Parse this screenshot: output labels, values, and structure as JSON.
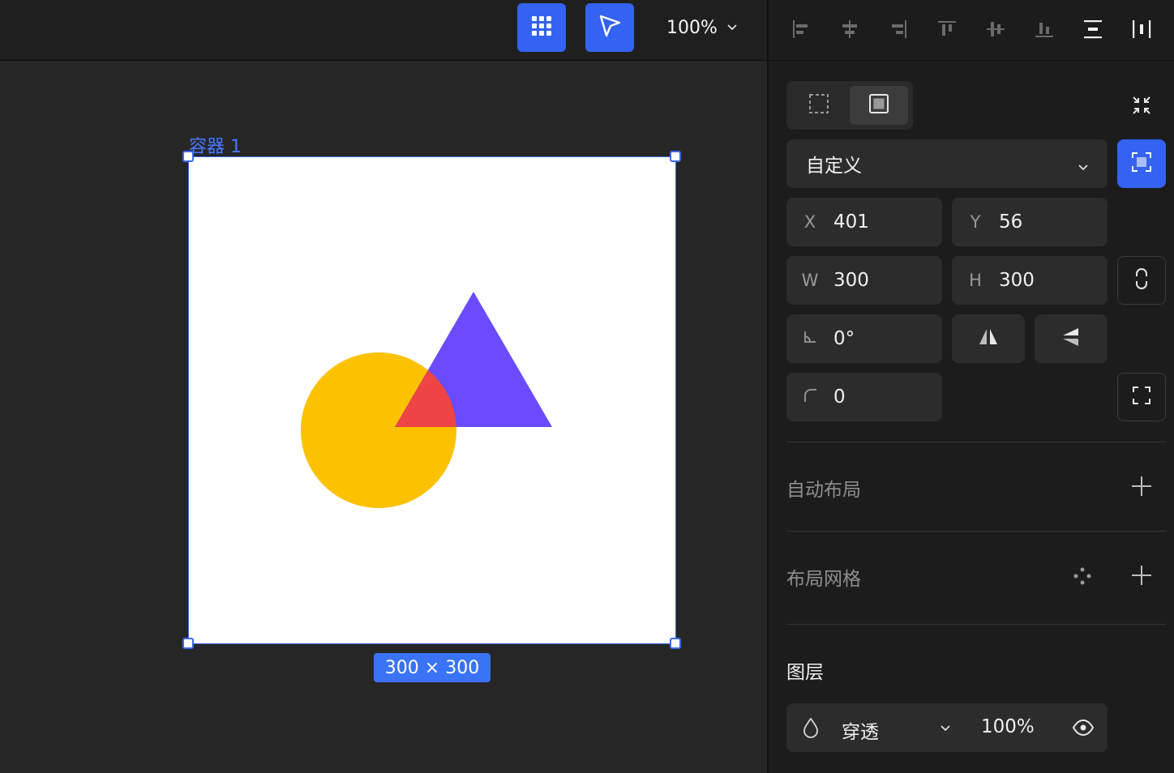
{
  "toolbar": {
    "zoom_value": "100%",
    "tools": [
      {
        "name": "grid-tool",
        "icon": "grid-icon",
        "active": true
      },
      {
        "name": "select-tool",
        "icon": "cursor-arrow-icon",
        "active": true
      }
    ]
  },
  "canvas": {
    "frame_label": "容器 1",
    "size_badge": "300 × 300",
    "accent_color": "#3a68f0",
    "shapes": [
      {
        "type": "circle",
        "color": "#fcc200"
      },
      {
        "type": "triangle",
        "color": "#6a4bff"
      },
      {
        "type": "intersection",
        "color": "#ef4444"
      }
    ]
  },
  "panel": {
    "align_icons": [
      "align-left-icon",
      "align-center-h-icon",
      "align-right-icon",
      "align-top-icon",
      "align-middle-v-icon",
      "align-bottom-icon",
      "distribute-vertical-icon",
      "distribute-horizontal-icon"
    ],
    "preset_dropdown": "自定义",
    "x_label": "X",
    "x_value": "401",
    "y_label": "Y",
    "y_value": "56",
    "w_label": "W",
    "w_value": "300",
    "h_label": "H",
    "h_value": "300",
    "rotation_value": "0°",
    "radius_value": "0",
    "auto_layout_title": "自动布局",
    "layout_grid_title": "布局网格",
    "layer_title": "图层",
    "blend_mode": "穿透",
    "opacity": "100%"
  }
}
